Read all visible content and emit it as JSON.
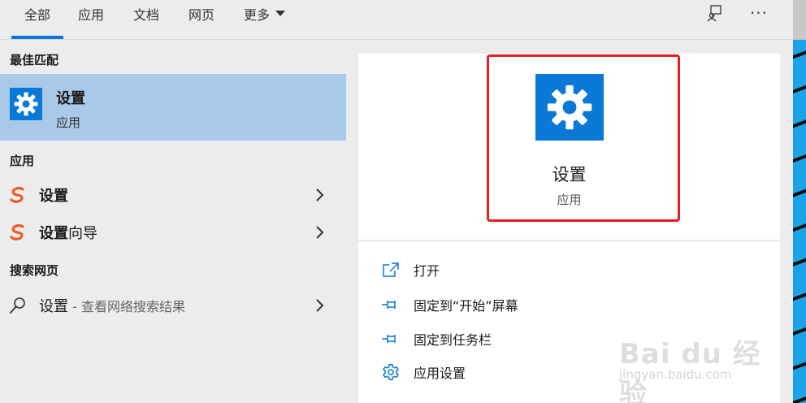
{
  "tabs": [
    {
      "label": "全部",
      "active": true
    },
    {
      "label": "应用"
    },
    {
      "label": "文档"
    },
    {
      "label": "网页"
    },
    {
      "label": "更多"
    }
  ],
  "header_icons": [
    "feedback-icon",
    "more-options-icon"
  ],
  "header_more_glyph": "···",
  "sections": {
    "best_match": "最佳匹配",
    "apps": "应用",
    "web": "搜索网页"
  },
  "best_match": {
    "name": "设置",
    "type": "应用",
    "icon": "gear-icon"
  },
  "app_results": [
    {
      "bold": "设置",
      "rest": "",
      "icon": "sogou-icon"
    },
    {
      "bold": "设置",
      "rest": "向导",
      "icon": "sogou-icon"
    }
  ],
  "web_result": {
    "query": "设置",
    "suffix": " - 查看网络搜索结果",
    "icon": "search-icon"
  },
  "preview": {
    "name": "设置",
    "type": "应用",
    "icon": "gear-icon"
  },
  "actions": [
    {
      "label": "打开",
      "icon": "open-icon"
    },
    {
      "label": "固定到“开始”屏幕",
      "icon": "pin-icon"
    },
    {
      "label": "固定到任务栏",
      "icon": "pin-icon"
    },
    {
      "label": "应用设置",
      "icon": "gear-icon"
    }
  ],
  "watermark": {
    "main": "Bai du 经验",
    "sub": "jingyan.baidu.com"
  },
  "colors": {
    "accent": "#0a78d7",
    "selected": "#a9c9e8",
    "highlight": "#e31e24",
    "sogou": "#f05a28"
  }
}
